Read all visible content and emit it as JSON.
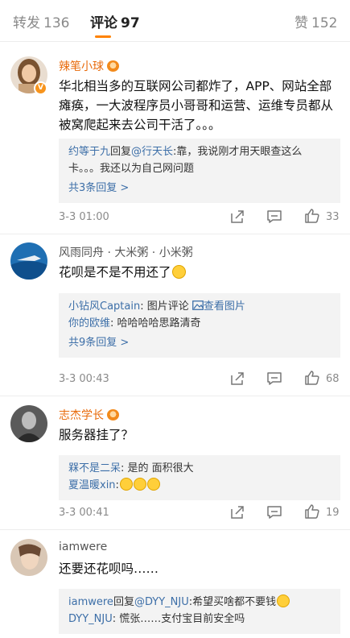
{
  "tabs": {
    "repost_label": "转发",
    "repost_count": "136",
    "comment_label": "评论",
    "comment_count": "97",
    "like_label": "赞",
    "like_count": "152"
  },
  "comments": [
    {
      "user": "辣笔小球",
      "text": "华北相当多的互联网公司都炸了，APP、网站全部瘫痪，一大波程序员小哥哥和运营、运维专员都从被窝爬起来去公司干活了。。。",
      "replies": [
        {
          "name": "约等于九",
          "mid": "回复",
          "mention": "@行天长",
          "text": ":靠，我说刚才用天眼查这么卡。。。我还以为自己网问题"
        }
      ],
      "more": "共3条回复 >",
      "time": "3-3 01:00",
      "likes": "33"
    },
    {
      "user": "风雨同舟 · 大米粥 · 小米粥",
      "text": "花呗是不是不用还了",
      "replies": [
        {
          "name": "小钻风Captain",
          "text": ": 图片评论 ",
          "link": "查看图片"
        },
        {
          "name": "你的欧维",
          "text": ": 哈哈哈哈思路清奇"
        }
      ],
      "more": "共9条回复 >",
      "time": "3-3 00:43",
      "likes": "68"
    },
    {
      "user": "志杰学长",
      "text": "服务器挂了？",
      "replies": [
        {
          "name": "槑不是二呆",
          "text": ": 是的 面积很大"
        },
        {
          "name": "夏温暖xin",
          "text": ":"
        }
      ],
      "time": "3-3 00:41",
      "likes": "19"
    },
    {
      "user": "iamwere",
      "text": "还要还花呗吗……",
      "replies": [
        {
          "name": "iamwere",
          "mid": "回复",
          "mention": "@DYY_NJU",
          "text": ":希望买啥都不要钱"
        },
        {
          "name": "DYY_NJU",
          "text": ": 慌张……支付宝目前安全吗"
        }
      ]
    }
  ],
  "colors": {
    "accent": "#ff8200",
    "link": "#3d6fa8",
    "username_vip": "#e86b0c"
  },
  "icons": [
    "share-icon",
    "comment-icon",
    "like-icon"
  ]
}
